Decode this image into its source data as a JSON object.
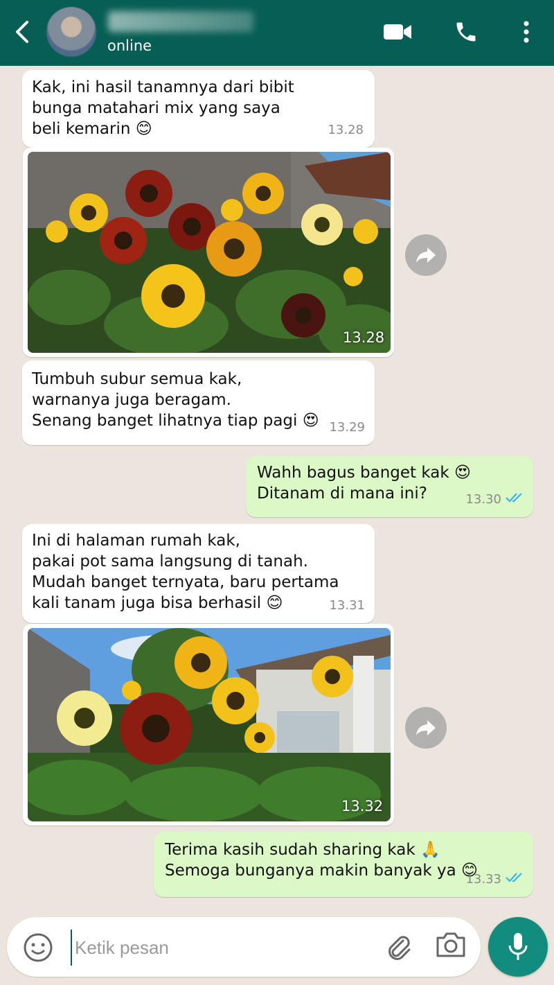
{
  "colors": {
    "header": "#075E54",
    "outgoing_bubble": "#DCF8C6",
    "incoming_bubble": "#FFFFFF",
    "accent": "#128C7E",
    "chat_bg": "#ECE5DD",
    "read_tick": "#34B7F1"
  },
  "header": {
    "status": "online",
    "icons": [
      "back-arrow-icon",
      "video-call-icon",
      "phone-icon",
      "more-vert-icon"
    ]
  },
  "messages": [
    {
      "type": "text",
      "direction": "in",
      "text": "Kak, ini hasil tanamnya dari bibit\nbunga matahari mix yang saya\nbeli kemarin 😊",
      "time": "13.28"
    },
    {
      "type": "image",
      "direction": "in",
      "description": "sunflowers by wall",
      "time": "13.28"
    },
    {
      "type": "text",
      "direction": "in",
      "text": "Tumbuh subur semua kak,\nwarnanya juga beragam.\nSenang banget lihatnya tiap pagi 😍",
      "time": "13.29"
    },
    {
      "type": "text",
      "direction": "out",
      "text": "Wahh bagus banget kak 😍\nDitanam di mana ini?",
      "time": "13.30"
    },
    {
      "type": "text",
      "direction": "in",
      "text": "Ini di halaman rumah kak,\npakai pot sama langsung di tanah.\nMudah banget ternyata, baru pertama\nkali tanam juga bisa berhasil 😊",
      "time": "13.31"
    },
    {
      "type": "image",
      "direction": "in",
      "description": "sunflowers in yard",
      "time": "13.32"
    },
    {
      "type": "text",
      "direction": "out",
      "text": "Terima kasih sudah sharing kak 🙏\nSemoga bunganya makin banyak ya 😊",
      "time": "13.33"
    }
  ],
  "input": {
    "placeholder": "Ketik pesan"
  }
}
